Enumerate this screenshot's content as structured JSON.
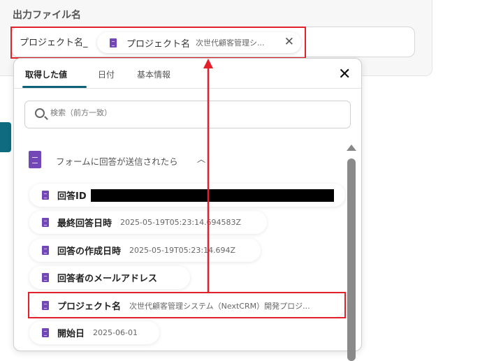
{
  "field": {
    "label": "出力ファイル名",
    "prefix_text": "プロジェクト名_",
    "chip": {
      "key": "プロジェクト名",
      "value": "次世代顧客管理シ...",
      "remove_icon": "close-icon"
    }
  },
  "popup": {
    "tabs": [
      {
        "label": "取得した値",
        "active": true
      },
      {
        "label": "日付"
      },
      {
        "label": "基本情報"
      }
    ],
    "close_icon": "close-icon",
    "search": {
      "placeholder": "検索（前方一致）",
      "value": ""
    },
    "section": {
      "title": "フォームに回答が送信されたら",
      "icon": "google-forms-icon",
      "expanded": true
    },
    "items": [
      {
        "key": "回答ID",
        "value": "",
        "redacted": true
      },
      {
        "key": "最終回答日時",
        "value": "2025-05-19T05:23:14.694583Z"
      },
      {
        "key": "回答の作成日時",
        "value": "2025-05-19T05:23:14.694Z"
      },
      {
        "key": "回答者のメールアドレス",
        "value": ""
      },
      {
        "key": "プロジェクト名",
        "value": "次世代顧客管理システム（NextCRM）開発プロジ...",
        "highlighted": true
      },
      {
        "key": "開始日",
        "value": "2025-06-01"
      }
    ]
  },
  "colors": {
    "accent": "#0c6377",
    "annotation": "#e3212a",
    "form_icon": "#7248b9"
  }
}
